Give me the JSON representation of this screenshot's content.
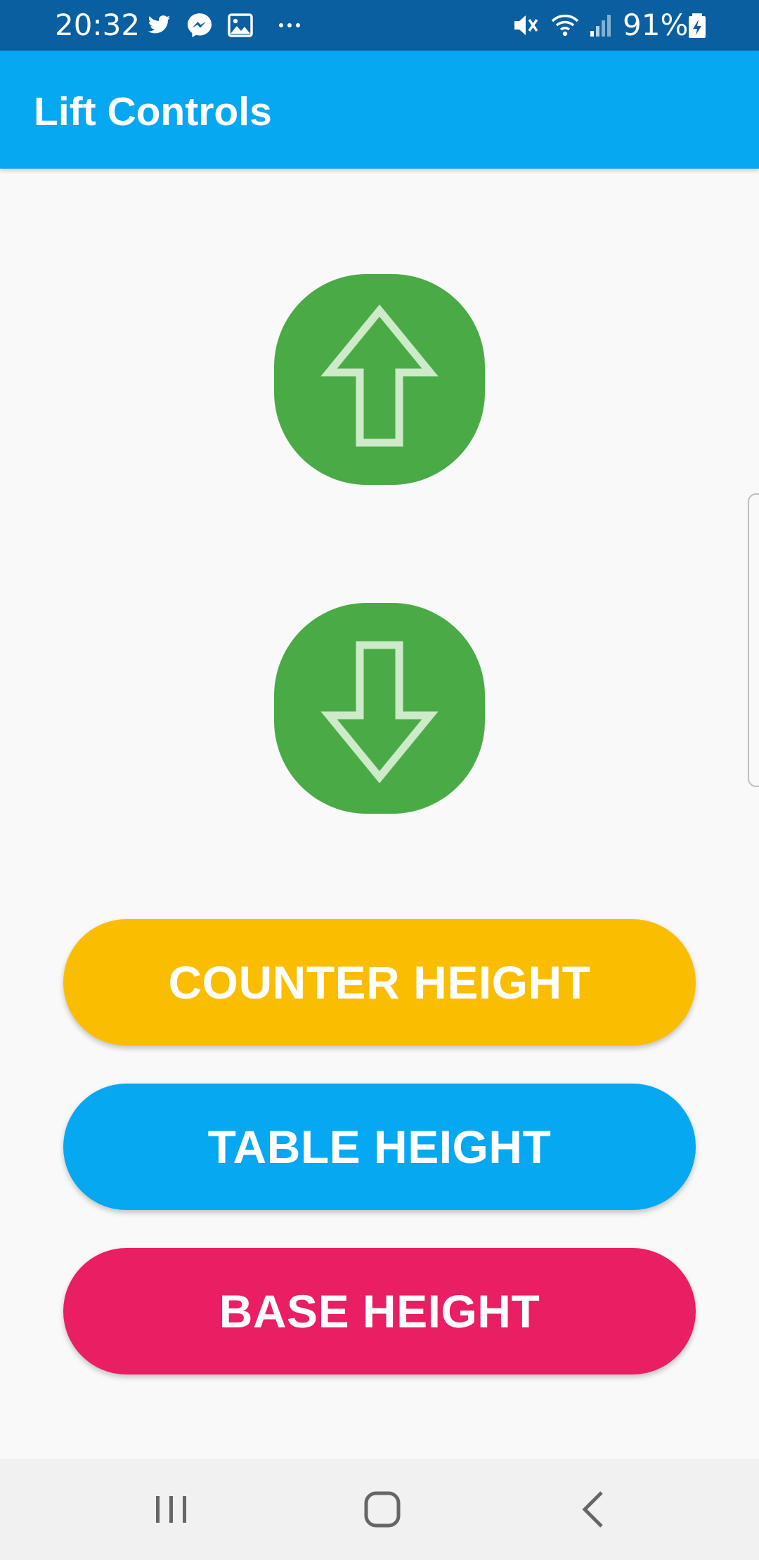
{
  "status_bar": {
    "time": "20:32",
    "left_icons": [
      "twitter-icon",
      "messenger-icon",
      "gallery-icon",
      "more-notifications-icon"
    ],
    "right_icons": [
      "mute-vibrate-icon",
      "wifi-icon",
      "signal-icon",
      "battery-charging-icon"
    ],
    "battery_percent": "91%"
  },
  "app_bar": {
    "title": "Lift Controls"
  },
  "controls": {
    "up_icon": "arrow-up-icon",
    "down_icon": "arrow-down-icon"
  },
  "presets": {
    "counter_label": "COUNTER HEIGHT",
    "table_label": "TABLE HEIGHT",
    "base_label": "BASE HEIGHT"
  },
  "colors": {
    "status_bar": "#0a5fa0",
    "app_bar": "#05a8f1",
    "arrow_button": "#4aab46",
    "counter_button": "#fbbd00",
    "table_button": "#05a8f1",
    "base_button": "#e91e63",
    "background": "#f9f9f9"
  },
  "nav_bar": {
    "icons": [
      "recent-apps-icon",
      "home-icon",
      "back-icon"
    ]
  }
}
